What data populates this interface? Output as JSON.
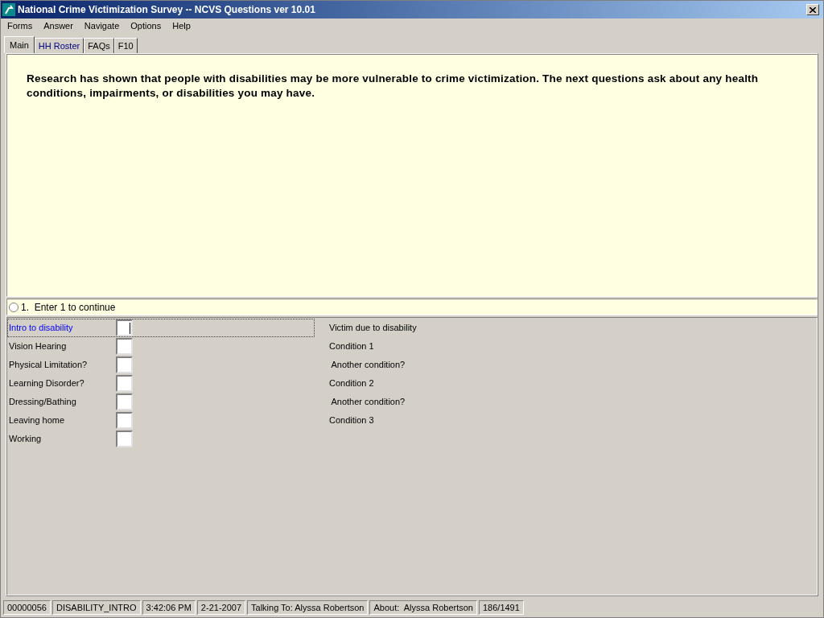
{
  "window": {
    "title": "National Crime Victimization Survey -- NCVS Questions ver 10.01"
  },
  "menu": [
    "Forms",
    "Answer",
    "Navigate",
    "Options",
    "Help"
  ],
  "tabs": [
    {
      "label": "Main",
      "selected": true,
      "kind": "plain"
    },
    {
      "label": "HH Roster",
      "selected": false,
      "kind": "link"
    },
    {
      "label": "FAQs",
      "selected": false,
      "kind": "plain"
    },
    {
      "label": "F10",
      "selected": false,
      "kind": "plain"
    }
  ],
  "question": {
    "text": "Research has shown that people with disabilities may be more vulnerable to crime victimization.  The next questions ask about any health conditions, impairments, or disabilities you may have."
  },
  "answers": [
    {
      "label": "1.  Enter 1 to continue",
      "selected": false
    }
  ],
  "fields": {
    "left": [
      {
        "label": "Intro to disability",
        "selected": true
      },
      {
        "label": "Vision Hearing",
        "selected": false
      },
      {
        "label": "Physical Limitation?",
        "selected": false
      },
      {
        "label": "Learning Disorder?",
        "selected": false
      },
      {
        "label": "Dressing/Bathing",
        "selected": false
      },
      {
        "label": "Leaving home",
        "selected": false
      },
      {
        "label": "Working",
        "selected": false
      }
    ],
    "right": [
      {
        "label": "Victim due to disability"
      },
      {
        "label": "Condition 1"
      },
      {
        "label": " Another condition?"
      },
      {
        "label": "Condition 2"
      },
      {
        "label": " Another condition?"
      },
      {
        "label": "Condition 3"
      }
    ]
  },
  "status_bar": [
    "00000056",
    "DISABILITY_INTRO",
    "3:42:06 PM",
    "2-21-2007",
    "Talking To: Alyssa Robertson",
    "About:  Alyssa Robertson",
    "186/1491"
  ]
}
